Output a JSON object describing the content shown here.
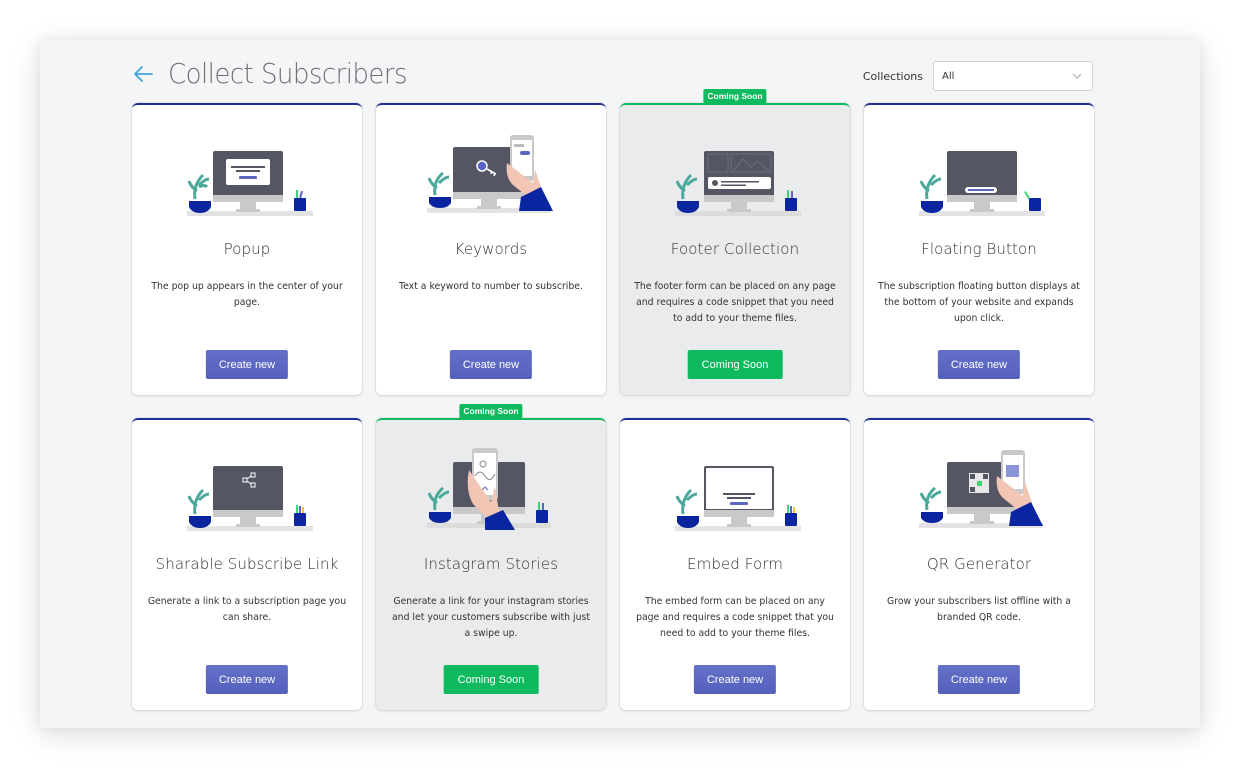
{
  "header": {
    "title": "Collect Subscribers",
    "back_icon": "arrow-left-icon",
    "filter_label": "Collections",
    "filter_value": "All",
    "filter_icon": "chevron-down-icon"
  },
  "colors": {
    "accent_blue": "#5a66c4",
    "card_top_border": "#1f2f95",
    "coming_soon_green": "#0fb95d",
    "back_arrow": "#3fa4d6"
  },
  "cards": [
    {
      "key": "popup",
      "title": "Popup",
      "description": "The pop up appears in the center of your page.",
      "button": "Create new",
      "coming_soon": false,
      "illustration": "monitor-popup-illustration"
    },
    {
      "key": "keywords",
      "title": "Keywords",
      "description": "Text a keyword to number to subscribe.",
      "button": "Create new",
      "coming_soon": false,
      "illustration": "monitor-key-phone-illustration"
    },
    {
      "key": "footer-collection",
      "title": "Footer Collection",
      "description": "The footer form can be placed on any page and requires a code snippet that you need to add to your theme files.",
      "button": "Coming Soon",
      "coming_soon": true,
      "ribbon": "Coming Soon",
      "illustration": "monitor-footer-illustration"
    },
    {
      "key": "floating-button",
      "title": "Floating Button",
      "description": "The subscription floating button displays at the bottom of your website and expands upon click.",
      "button": "Create new",
      "coming_soon": false,
      "illustration": "monitor-floating-button-illustration"
    },
    {
      "key": "sharable-link",
      "title": "Sharable Subscribe Link",
      "description": "Generate a link to a subscription page you can share.",
      "button": "Create new",
      "coming_soon": false,
      "illustration": "monitor-share-illustration"
    },
    {
      "key": "instagram-stories",
      "title": "Instagram Stories",
      "description": "Generate a link for your instagram stories and let your customers subscribe with just a swipe up.",
      "button": "Coming Soon",
      "coming_soon": true,
      "ribbon": "Coming Soon",
      "illustration": "phone-story-illustration"
    },
    {
      "key": "embed-form",
      "title": "Embed Form",
      "description": "The embed form can be placed on any page and requires a code snippet that you need to add to your theme files.",
      "button": "Create new",
      "coming_soon": false,
      "illustration": "monitor-embed-form-illustration"
    },
    {
      "key": "qr-generator",
      "title": "QR Generator",
      "description": "Grow your subscribers list offline with a branded QR code.",
      "button": "Create new",
      "coming_soon": false,
      "illustration": "monitor-qr-phone-illustration"
    }
  ]
}
